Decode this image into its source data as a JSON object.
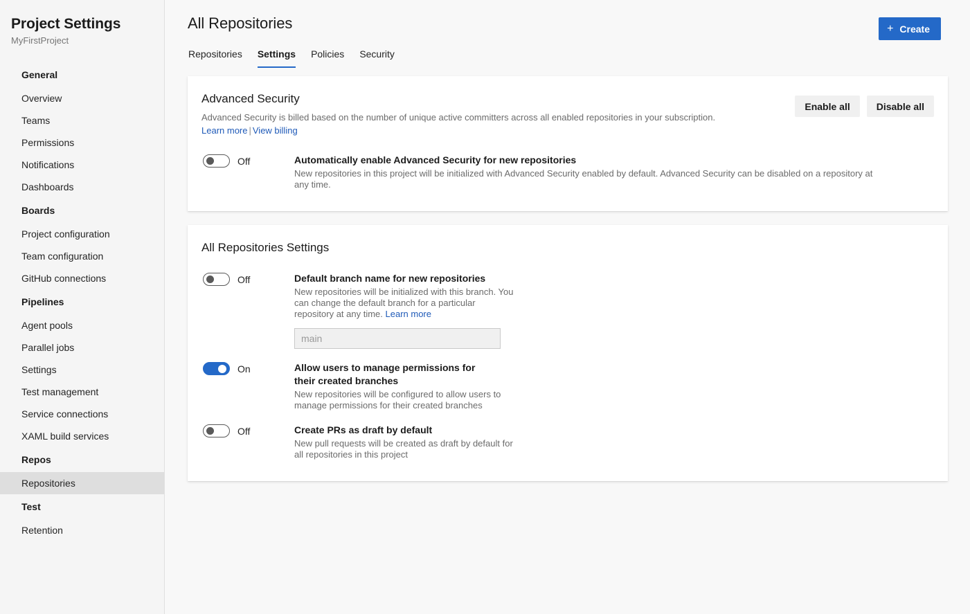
{
  "sidebar": {
    "title": "Project Settings",
    "project": "MyFirstProject",
    "groups": [
      {
        "title": "General",
        "items": [
          "Overview",
          "Teams",
          "Permissions",
          "Notifications",
          "Dashboards"
        ]
      },
      {
        "title": "Boards",
        "items": [
          "Project configuration",
          "Team configuration",
          "GitHub connections"
        ]
      },
      {
        "title": "Pipelines",
        "items": [
          "Agent pools",
          "Parallel jobs",
          "Settings",
          "Test management",
          "Service connections",
          "XAML build services"
        ]
      },
      {
        "title": "Repos",
        "items": [
          "Repositories"
        ]
      },
      {
        "title": "Test",
        "items": [
          "Retention"
        ]
      }
    ],
    "selected_item": "Repositories"
  },
  "header": {
    "title": "All Repositories",
    "create_label": "Create",
    "plus_icon": "+",
    "tabs": [
      {
        "label": "Repositories",
        "active": false
      },
      {
        "label": "Settings",
        "active": true
      },
      {
        "label": "Policies",
        "active": false
      },
      {
        "label": "Security",
        "active": false
      }
    ]
  },
  "advanced_security": {
    "heading": "Advanced Security",
    "description": "Advanced Security is billed based on the number of unique active committers across all enabled repositories in your subscription.",
    "learn_more": "Learn more",
    "separator": "|",
    "view_billing": "View billing",
    "enable_all": "Enable all",
    "disable_all": "Disable all",
    "toggle": {
      "state": "Off",
      "title": "Automatically enable Advanced Security for new repositories",
      "description": "New repositories in this project will be initialized with Advanced Security enabled by default. Advanced Security can be disabled on a repository at any time."
    }
  },
  "all_repo_settings": {
    "heading": "All Repositories Settings",
    "default_branch": {
      "state": "Off",
      "title": "Default branch name for new repositories",
      "description": "New repositories will be initialized with this branch. You can change the default branch for a particular repository at any time.",
      "learn_more": "Learn more",
      "input_placeholder": "main",
      "input_value": ""
    },
    "manage_permissions": {
      "state": "On",
      "title": "Allow users to manage permissions for their created branches",
      "description": "New repositories will be configured to allow users to manage permissions for their created branches"
    },
    "draft_prs": {
      "state": "Off",
      "title": "Create PRs as draft by default",
      "description": "New pull requests will be created as draft by default for all repositories in this project"
    }
  },
  "colors": {
    "accent": "#2469c8",
    "link": "#1f5ab8",
    "sidebar_bg": "#f5f5f5",
    "page_bg": "#f8f8f8"
  }
}
